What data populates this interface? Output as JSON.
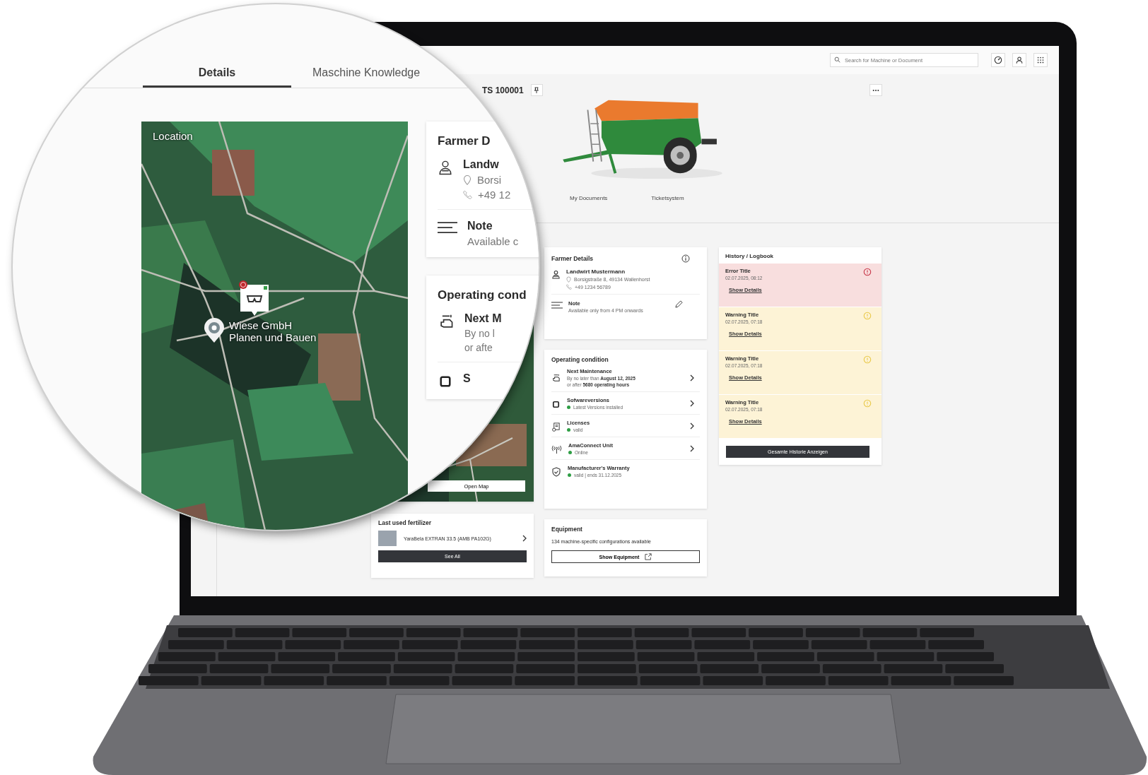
{
  "header": {
    "search": {
      "placeholder": "Search for Machine or Document"
    }
  },
  "machine": {
    "title": "TS 100001"
  },
  "tabs": [
    {
      "label": "My Documents",
      "selected": false
    },
    {
      "label": "Ticketsystem",
      "selected": false
    }
  ],
  "map_card": {
    "button": "Open Map"
  },
  "fertilizer": {
    "title": "Last used fertilizer",
    "name": "YaraBela EXTRAN 33.5 (AMB PA102G)",
    "button": "See All"
  },
  "farmer": {
    "title": "Farmer Details",
    "name": "Landwirt Mustermann",
    "address": "Borsigstraße 8, 49134 Wallenhorst",
    "phone": "+49 1234 56789",
    "note_title": "Note",
    "note_text": "Available only from 4 PM onwards"
  },
  "operating": {
    "title": "Operating condition",
    "rows": [
      {
        "kind": "schedule",
        "title": "Next Maintenance",
        "lines": [
          "By no later than **August 12, 2025**",
          "or after **5680 operating hours**"
        ]
      },
      {
        "kind": "status",
        "title": "Sofwareversions",
        "status": {
          "text": "Latest Versions installed",
          "color": "#2e9e44"
        }
      },
      {
        "kind": "status",
        "title": "Licenses",
        "status": {
          "text": "valid",
          "color": "#2e9e44"
        }
      },
      {
        "kind": "status",
        "title": "AmaConnect Unit",
        "status": {
          "text": "Online",
          "color": "#2e9e44"
        }
      },
      {
        "kind": "status",
        "title": "Manufacturer's Warranty",
        "status": {
          "text": "valid | ends 31.12.2025",
          "color": "#2e9e44"
        }
      }
    ]
  },
  "equipment": {
    "title": "Equipment",
    "text": "134 machine-specific configurations available",
    "button": "Show Equipment"
  },
  "history": {
    "title": "History / Logbook",
    "items": [
      {
        "kind": "error",
        "title": "Error Title",
        "time": "02.07.2025, 08:12",
        "link": "Show Details"
      },
      {
        "kind": "warning",
        "title": "Warning Title",
        "time": "02.07.2025, 07:18",
        "link": "Show Details"
      },
      {
        "kind": "warning",
        "title": "Warning Title",
        "time": "02.07.2025, 07:18",
        "link": "Show Details"
      },
      {
        "kind": "warning",
        "title": "Warning Title",
        "time": "02.07.2025, 07:18",
        "link": "Show Details"
      }
    ],
    "button": "Gesamte Historie Anzeigen"
  },
  "magnifier": {
    "tabs": [
      {
        "label": "Details",
        "selected": true
      },
      {
        "label": "Maschine Knowledge",
        "selected": false
      }
    ],
    "map": {
      "title": "Location",
      "marker_label": [
        "Wiese GmbH",
        "Planen und Bauen"
      ]
    },
    "farmer_card": {
      "title": "Farmer D",
      "name": "Landw",
      "address": "Borsi",
      "phone": "+49 12",
      "note_title": "Note",
      "note_text": "Available c"
    },
    "operating_card": {
      "title": "Operating cond",
      "row_title": "Next M",
      "row_lines": [
        "By no l",
        "or afte"
      ],
      "second_row_title": "S"
    }
  }
}
